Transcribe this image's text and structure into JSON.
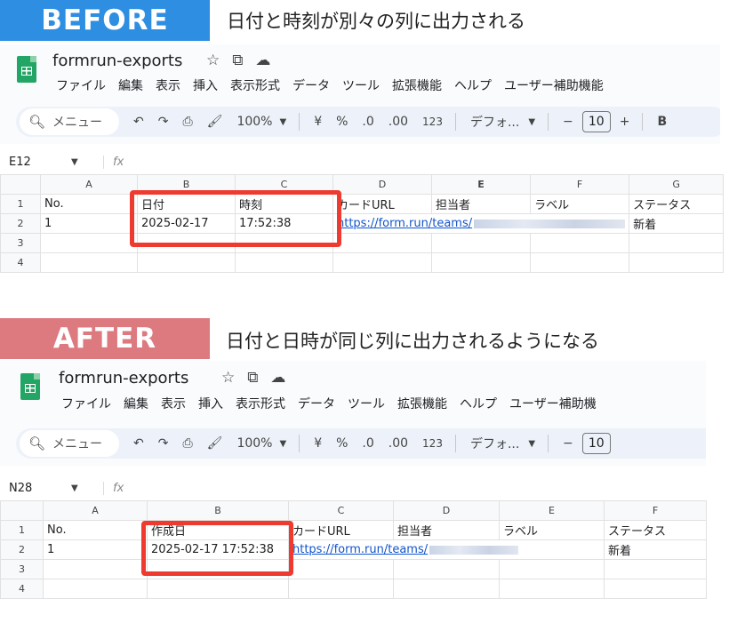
{
  "before": {
    "banner": "BEFORE",
    "caption": "日付と時刻が別々の列に出力される",
    "title": "formrun-exports",
    "menu": [
      "ファイル",
      "編集",
      "表示",
      "挿入",
      "表示形式",
      "データ",
      "ツール",
      "拡張機能",
      "ヘルプ",
      "ユーザー補助機能"
    ],
    "toolbar": {
      "search": "メニュー",
      "zoom": "100%",
      "currency": "¥",
      "percent": "%",
      "dec_dec": ".0",
      "dec_inc": ".00",
      "fmt123": "123",
      "font": "デフォ...",
      "minus": "−",
      "font_size": "10",
      "plus": "+",
      "bold": "B"
    },
    "cell_ref": "E12",
    "fx": "fx",
    "columns": [
      "A",
      "B",
      "C",
      "D",
      "E",
      "F",
      "G"
    ],
    "rows": [
      {
        "n": "1",
        "cells": [
          "No.",
          "日付",
          "時刻",
          "カードURL",
          "担当者",
          "ラベル",
          "ステータス"
        ]
      },
      {
        "n": "2",
        "cells": [
          "1",
          "2025-02-17",
          "17:52:38",
          "https://form.run/teams/",
          "",
          "",
          "新着"
        ]
      },
      {
        "n": "3",
        "cells": [
          "",
          "",
          "",
          "",
          "",
          "",
          ""
        ]
      },
      {
        "n": "4",
        "cells": [
          "",
          "",
          "",
          "",
          "",
          "",
          ""
        ]
      }
    ]
  },
  "after": {
    "banner": "AFTER",
    "caption": "日付と日時が同じ列に出力されるようになる",
    "title": "formrun-exports",
    "menu": [
      "ファイル",
      "編集",
      "表示",
      "挿入",
      "表示形式",
      "データ",
      "ツール",
      "拡張機能",
      "ヘルプ",
      "ユーザー補助機"
    ],
    "toolbar": {
      "search": "メニュー",
      "zoom": "100%",
      "currency": "¥",
      "percent": "%",
      "dec_dec": ".0",
      "dec_inc": ".00",
      "fmt123": "123",
      "font": "デフォ...",
      "minus": "−",
      "font_size": "10"
    },
    "cell_ref": "N28",
    "fx": "fx",
    "columns": [
      "A",
      "B",
      "C",
      "D",
      "E",
      "F"
    ],
    "rows": [
      {
        "n": "1",
        "cells": [
          "No.",
          "作成日",
          "カードURL",
          "担当者",
          "ラベル",
          "ステータス"
        ]
      },
      {
        "n": "2",
        "cells": [
          "1",
          "2025-02-17 17:52:38",
          "https://form.run/teams/",
          "",
          "",
          "新着"
        ]
      },
      {
        "n": "3",
        "cells": [
          "",
          "",
          "",
          "",
          "",
          ""
        ]
      },
      {
        "n": "4",
        "cells": [
          "",
          "",
          "",
          "",
          "",
          ""
        ]
      }
    ]
  },
  "icons": {
    "star": "star-icon",
    "folder": "move-folder-icon",
    "cloud": "cloud-status-icon",
    "undo": "undo-icon",
    "redo": "redo-icon",
    "print": "print-icon",
    "paint": "paint-format-icon"
  },
  "colors": {
    "before_banner": "#2d8ee2",
    "after_banner": "#dc7a80",
    "highlight": "#ef3a2f",
    "link": "#1155cc",
    "selected_col": "#d3e3fd"
  }
}
